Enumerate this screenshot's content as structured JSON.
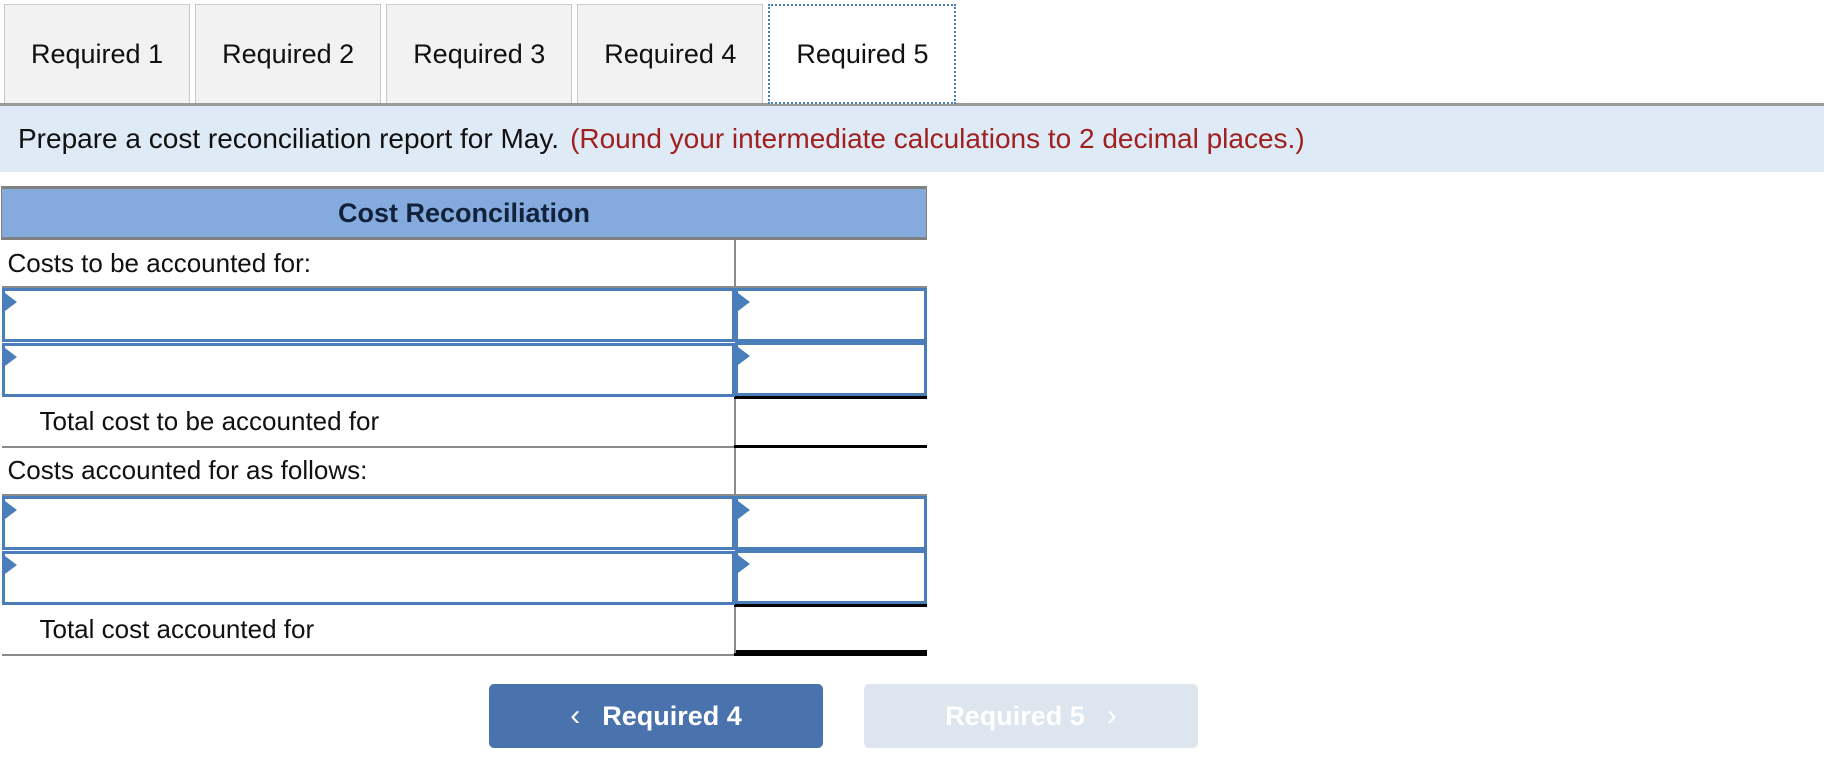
{
  "tabs": [
    {
      "label": "Required 1",
      "active": false
    },
    {
      "label": "Required 2",
      "active": false
    },
    {
      "label": "Required 3",
      "active": false
    },
    {
      "label": "Required 4",
      "active": false
    },
    {
      "label": "Required 5",
      "active": true
    }
  ],
  "banner": {
    "instruction": "Prepare a cost reconciliation report for May.",
    "hint": "(Round your intermediate calculations to 2 decimal places.)"
  },
  "worksheet": {
    "title": "Cost Reconciliation",
    "rows": [
      {
        "type": "text",
        "label": "Costs to be accounted for:",
        "value": ""
      },
      {
        "type": "entry",
        "label": "",
        "value": ""
      },
      {
        "type": "entry",
        "label": "",
        "value": ""
      },
      {
        "type": "total",
        "label": "Total cost to be accounted for",
        "value": "",
        "rule": "single"
      },
      {
        "type": "text",
        "label": "Costs accounted for as follows:",
        "value": ""
      },
      {
        "type": "entry",
        "label": "",
        "value": ""
      },
      {
        "type": "entry",
        "label": "",
        "value": ""
      },
      {
        "type": "total",
        "label": "Total cost accounted for",
        "value": "",
        "rule": "double"
      }
    ]
  },
  "nav": {
    "prev_label": "Required 4",
    "prev_icon": "chevron-left-icon",
    "prev_glyph": "‹",
    "next_label": "Required 5",
    "next_icon": "chevron-right-icon",
    "next_glyph": "›",
    "next_disabled": true
  },
  "colors": {
    "header_blue": "#85aadd",
    "banner_blue": "#dfeaf7",
    "field_border": "#4a7ebb",
    "hint_red": "#a02020",
    "button_blue": "#4a72ac",
    "button_disabled": "#dde5ef"
  }
}
